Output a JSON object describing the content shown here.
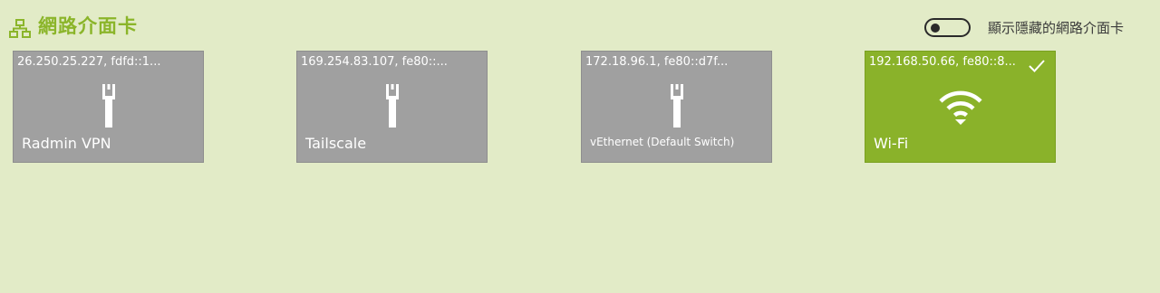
{
  "header": {
    "title": "網路介面卡",
    "icon": "network-icon",
    "accent_color": "#8bb52a"
  },
  "toggle": {
    "label": "顯示隱藏的網路介面卡",
    "state": "off"
  },
  "adapters": [
    {
      "ip": "26.250.25.227, fdfd::1...",
      "name": "Radmin VPN",
      "icon": "ethernet-icon",
      "selected": false
    },
    {
      "ip": "169.254.83.107, fe80::...",
      "name": "Tailscale",
      "icon": "ethernet-icon",
      "selected": false
    },
    {
      "ip": "172.18.96.1, fe80::d7f...",
      "name": "vEthernet (Default Switch)",
      "icon": "ethernet-icon",
      "selected": false
    },
    {
      "ip": "192.168.50.66, fe80::8...",
      "name": "Wi-Fi",
      "icon": "wifi-icon",
      "selected": true,
      "selected_icon": "checkmark-icon"
    }
  ],
  "colors": {
    "background": "#e2ebc7",
    "card_inactive": "#a0a0a0",
    "card_active": "#8ab22a"
  }
}
